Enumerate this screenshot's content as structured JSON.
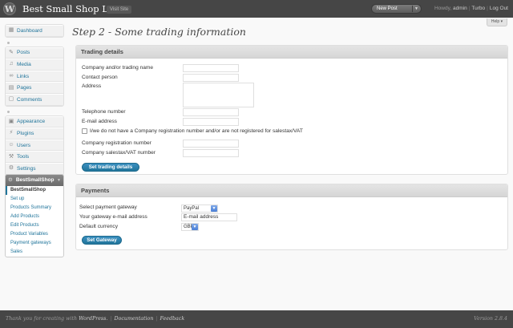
{
  "header": {
    "site_title": "Best Small Shop Lite",
    "visit_site": "Visit Site",
    "new_post": "New Post",
    "howdy_prefix": "Howdy,",
    "user": "admin",
    "turbo": "Turbo",
    "logout": "Log Out"
  },
  "help": "Help",
  "sidebar": {
    "dashboard": "Dashboard",
    "group2": [
      "Posts",
      "Media",
      "Links",
      "Pages",
      "Comments"
    ],
    "group3": [
      "Appearance",
      "Plugins",
      "Users",
      "Tools",
      "Settings"
    ],
    "shop": {
      "title": "BestSmallShop",
      "items": [
        "BestSmallShop",
        "Set up",
        "Products Summary",
        "Add Products",
        "Edit Products",
        "Product Variables",
        "Payment gateways",
        "Sales"
      ]
    }
  },
  "main": {
    "title": "Step 2 - Some trading information",
    "trading": {
      "heading": "Trading details",
      "company_label": "Company and/or trading name",
      "contact_label": "Contact person",
      "address_label": "Address",
      "telephone_label": "Telephone number",
      "email_label": "E-mail address",
      "checkbox_label": "I/we do not have a Company registration number and/or are not registered for salestax/VAT",
      "regno_label": "Company registration number",
      "vat_label": "Company salestax/VAT number",
      "button": "Set trading details"
    },
    "payments": {
      "heading": "Payments",
      "gateway_label": "Select payment gateway",
      "gateway_value": "PayPal",
      "email_label": "Your gateway e-mail address",
      "email_value": "E-mail address",
      "currency_label": "Default currency",
      "currency_value": "GBP",
      "button": "Set Gateway"
    }
  },
  "footer": {
    "thanks": "Thank you for creating with",
    "wordpress": "WordPress.",
    "documentation": "Documentation",
    "feedback": "Feedback",
    "version": "Version 2.8.4"
  }
}
